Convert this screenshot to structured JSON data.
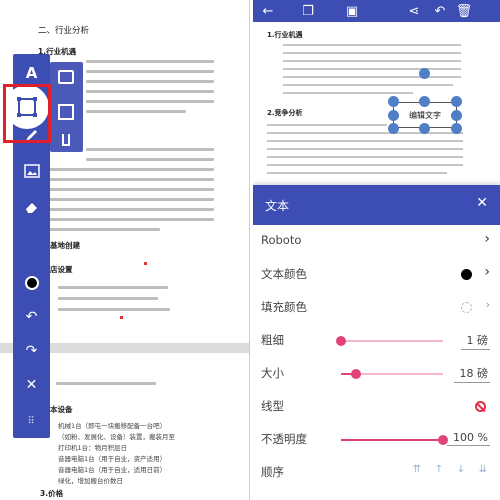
{
  "left_doc": {
    "section_title": "二、行业分析",
    "subsection_1": "1.行业机遇",
    "subsection_base": "基地创建",
    "subsection_site": "店设置",
    "subsection_equipment": "本设备",
    "subsection_price": "3.价格",
    "list_lines": [
      "机械1台（即屯一块搬移配备一台吧）",
      "（如粉、发展化、设备）装置，搬装月至",
      "打印机1台：物月积层日",
      "音器电脑1台（用于自业，资产适用）",
      "音器电脑1台（用于自业，适用日前）",
      "绿化，增加搬台价数日"
    ]
  },
  "toolbar": {
    "text_tool_label": "A",
    "tools": [
      "text-icon",
      "shape-icon",
      "pen-icon",
      "image-icon",
      "eraser-icon",
      "color-icon",
      "undo-icon",
      "redo-icon",
      "close-icon",
      "drag-handle-icon"
    ]
  },
  "right_doc": {
    "subsection_1": "1.行业机遇",
    "subsection_2": "2.竞争分析",
    "edit_box_text": "编辑文字"
  },
  "text_panel": {
    "title": "文本",
    "font": "Roboto",
    "text_color_label": "文本颜色",
    "fill_color_label": "填充颜色",
    "weight_label": "粗细",
    "weight_value": "1 磅",
    "size_label": "大小",
    "size_value": "18 磅",
    "line_label": "线型",
    "opacity_label": "不透明度",
    "opacity_value": "100 %",
    "order_label": "顺序",
    "text_color": "#000000",
    "accent_color": "#3c4db3",
    "slider_color": "#e2427a",
    "weight_fraction": 0.0,
    "size_fraction": 0.15,
    "opacity_fraction": 1.0
  }
}
